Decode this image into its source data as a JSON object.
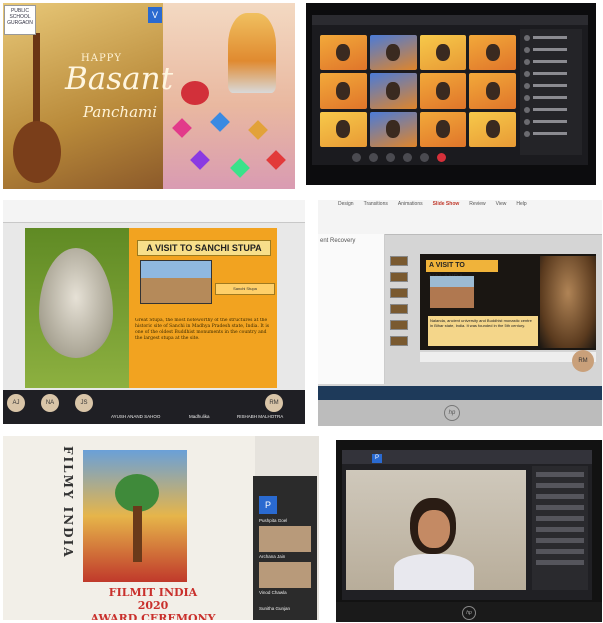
{
  "photo1": {
    "school_label": "PUBLIC SCHOOL GURGAON",
    "v_label": "V",
    "happy": "HAPPY",
    "basant": "Basant",
    "panchami": "Panchami"
  },
  "photo3": {
    "slide_title": "A VISIT TO SANCHI STUPA",
    "caption": "Sanchi Stupa",
    "body_text": "Great Stupa, the most noteworthy of the structures at the historic site of Sanchi in Madhya Pradesh state, India. It is one of the oldest Buddhist monuments in the country and the largest stupa at the site.",
    "participants": [
      {
        "initials": "AJ",
        "name": ""
      },
      {
        "initials": "NA",
        "name": ""
      },
      {
        "initials": "JS",
        "name": ""
      },
      {
        "initials": "",
        "name": "AYUSH ANAND SAHOO"
      },
      {
        "initials": "",
        "name": "Madhulika"
      },
      {
        "initials": "RM",
        "name": "RISHABH MALHOTRA"
      }
    ]
  },
  "photo4": {
    "tabs": [
      "Design",
      "Transitions",
      "Animations",
      "Slide Show",
      "Review",
      "View",
      "Help"
    ],
    "recovery_label": "ent Recovery",
    "slide_title": "A VISIT TO NALANDA",
    "body_text": "Nalanda, ancient university and Buddhist monastic centre in Bihar state, India. It was founded in the 5th century.",
    "speaker_initials": "RM",
    "hp_logo": "hp"
  },
  "photo5": {
    "filmy_india": "FILMY INDIA",
    "award_line1": "FILMIT INDIA",
    "award_line2": "2020",
    "award_line3": "AWARD CEREMONY",
    "p_tile": "P",
    "participants": [
      "Pushpita Goel",
      "Archana Jain",
      "Vinod Chawla",
      "Sunitha Gunjan"
    ]
  },
  "photo6": {
    "p_tile": "P",
    "hp_logo": "hp"
  }
}
